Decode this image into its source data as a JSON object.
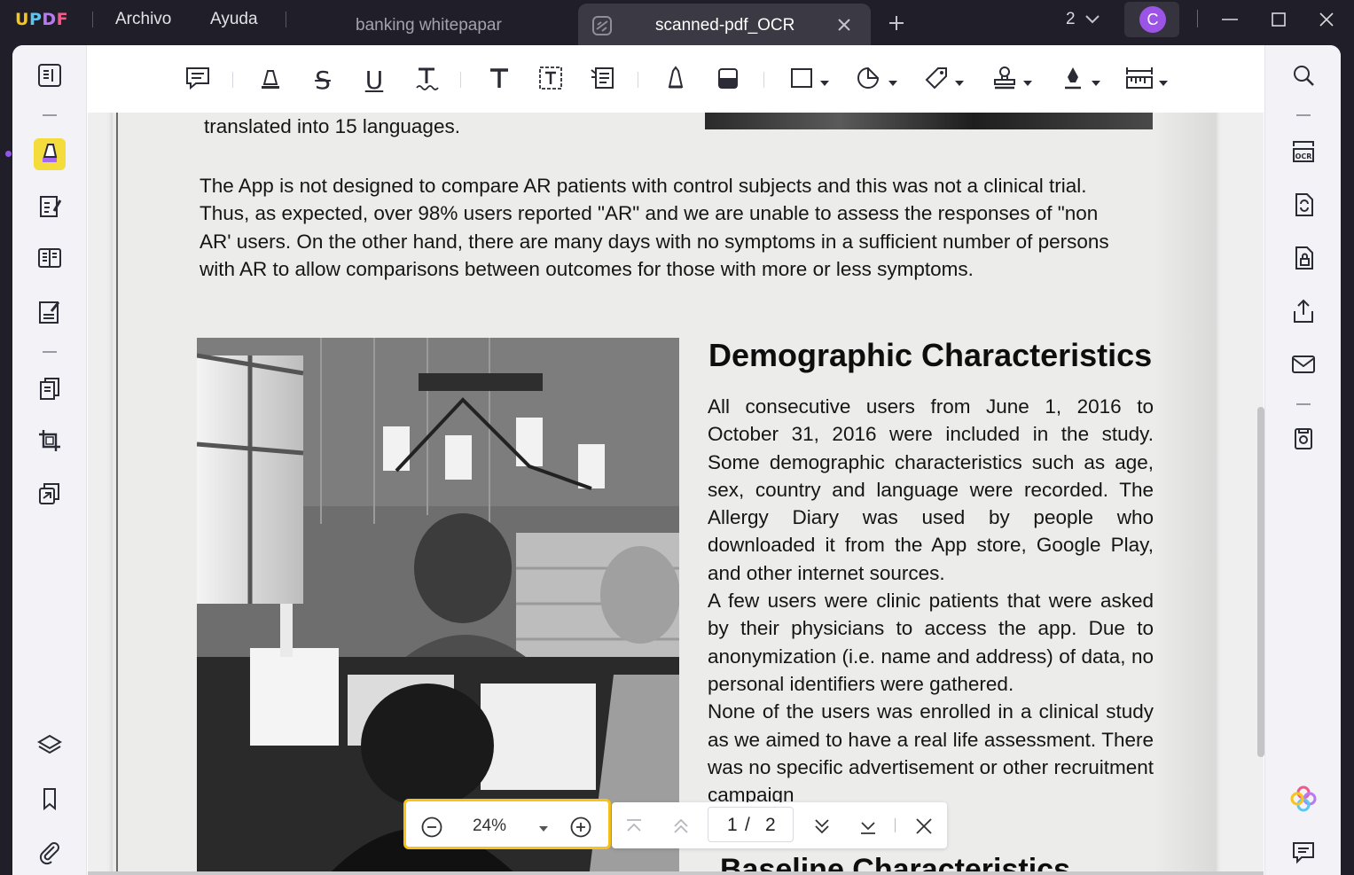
{
  "app": {
    "logo": [
      "U",
      "P",
      "D",
      "F"
    ],
    "menu": [
      "Archivo",
      "Ayuda"
    ],
    "tabs": [
      {
        "title": "banking whitepapar",
        "active": false
      },
      {
        "title": "scanned-pdf_OCR",
        "active": true
      }
    ],
    "open_docs_count": "2",
    "user_initial": "C"
  },
  "toolbar": {
    "tools": [
      "comment-icon",
      "highlight-icon",
      "strikethrough-icon",
      "underline-icon",
      "squiggly-icon",
      "text-icon",
      "textbox-icon",
      "text-callout-icon",
      "pencil-icon",
      "eraser-icon",
      "rectangle-icon",
      "sticker-icon",
      "tag-icon",
      "stamp-icon",
      "signature-icon",
      "measure-icon"
    ]
  },
  "document": {
    "top_line": "translated into 15 languages.",
    "paragraph1": [
      "The App is not designed to compare AR patients with control subjects and this was not a clinical trial.",
      "Thus, as expected, over 98% users reported \"AR\" and we are unable to assess the responses of \"non",
      "AR' users. On the other hand, there are many days with no symptoms in a sufficient number of persons",
      "with AR to allow comparisons between outcomes for those with more or less symptoms."
    ],
    "heading1": "Demographic Characteristics",
    "right_para1": "All consecutive users from June 1, 2016 to October 31, 2016 were included in the study. Some demographic characteristics such as age, sex, country and language were recorded. The Allergy Diary was used by people who downloaded it from the App store, Google Play, and other internet sources.",
    "right_para2": "A few users were clinic patients that were asked by their physicians to access the app. Due to anonymization (i.e. name and address) of data, no personal identifiers were gathered.",
    "right_para3": "None of the users was enrolled in a clinical study as we aimed to have a real life assessment. There was no specific advertisement or other   recruitment campaign",
    "heading2": "Baseline Characteristics"
  },
  "zoom": {
    "value": "24%"
  },
  "pagination": {
    "current": "1",
    "separator": "/",
    "total": "2"
  },
  "colors": {
    "accent_highlight": "#f8c21a",
    "avatar": "#9c54e6",
    "active_tool": "#f3dc3c"
  }
}
